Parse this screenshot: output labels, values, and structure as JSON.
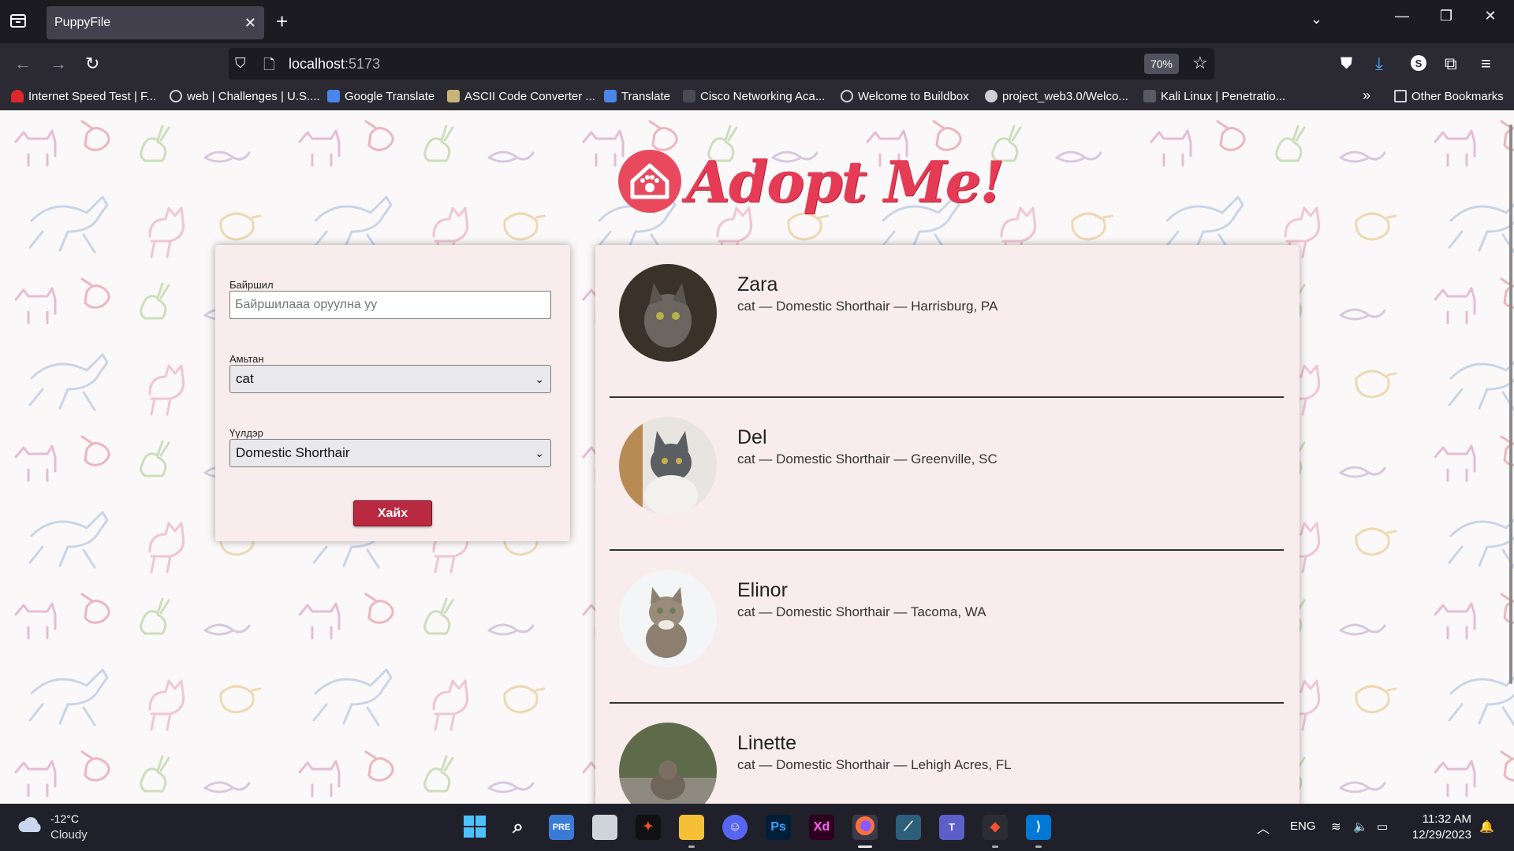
{
  "browser": {
    "tab_title": "PuppyFile",
    "url_host": "localhost",
    "url_port": ":5173",
    "zoom": "70%",
    "bookmarks": [
      {
        "label": "Internet Speed Test | F...",
        "icon_color": "#e0262b"
      },
      {
        "label": "web | Challenges | U.S....",
        "icon_color": "#cfcfd8"
      },
      {
        "label": "Google Translate",
        "icon_color": "#4a86e8"
      },
      {
        "label": "ASCII Code Converter ...",
        "icon_color": "#c9b37a"
      },
      {
        "label": "Translate",
        "icon_color": "#4a86e8"
      },
      {
        "label": "Cisco Networking Aca...",
        "icon_color": "#4a4a55"
      },
      {
        "label": "Welcome to Buildbox",
        "icon_color": "#cfcfd8"
      },
      {
        "label": "project_web3.0/Welco...",
        "icon_color": "#cfcfd8"
      },
      {
        "label": "Kali Linux | Penetratio...",
        "icon_color": "#5a5a66"
      }
    ],
    "other_bookmarks": "Other Bookmarks"
  },
  "app": {
    "logo_text": "Adopt Me!",
    "accent_color": "#e63b55",
    "search_form": {
      "location_label": "Байршил",
      "location_placeholder": "Байршилааа оруулна уу",
      "location_value": "",
      "animal_label": "Амьтан",
      "animal_value": "cat",
      "breed_label": "Үүлдэр",
      "breed_value": "Domestic Shorthair",
      "submit_label": "Хайх"
    },
    "pets": [
      {
        "name": "Zara",
        "desc": "cat — Domestic Shorthair — Harrisburg, PA",
        "photo": "dark-tabby-cat"
      },
      {
        "name": "Del",
        "desc": "cat — Domestic Shorthair — Greenville, SC",
        "photo": "gray-white-cat"
      },
      {
        "name": "Elinor",
        "desc": "cat — Domestic Shorthair — Tacoma, WA",
        "photo": "tabby-kitten"
      },
      {
        "name": "Linette",
        "desc": "cat — Domestic Shorthair — Lehigh Acres, FL",
        "photo": "outdoor-tabby-cat"
      }
    ]
  },
  "taskbar": {
    "weather_temp": "-12°C",
    "weather_condition": "Cloudy",
    "apps": [
      "start",
      "search",
      "powerbi",
      "file-manager",
      "figma",
      "explorer",
      "discord",
      "photoshop",
      "xd",
      "firefox",
      "mysql-workbench",
      "teams",
      "git",
      "vscode"
    ],
    "language": "ENG",
    "time": "11:32 AM",
    "date": "12/29/2023"
  }
}
